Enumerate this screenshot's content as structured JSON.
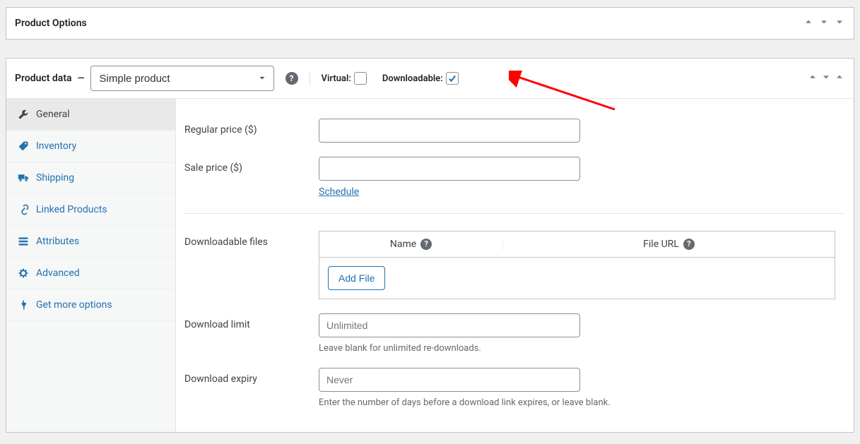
{
  "product_options": {
    "title": "Product Options"
  },
  "product_data": {
    "title": "Product data",
    "type_selected": "Simple product",
    "virtual": {
      "label": "Virtual:",
      "checked": false
    },
    "downloadable": {
      "label": "Downloadable:",
      "checked": true
    }
  },
  "tabs": {
    "general": "General",
    "inventory": "Inventory",
    "shipping": "Shipping",
    "linked": "Linked Products",
    "attributes": "Attributes",
    "advanced": "Advanced",
    "get_more": "Get more options"
  },
  "general": {
    "regular_price_label": "Regular price ($)",
    "sale_price_label": "Sale price ($)",
    "schedule_link": "Schedule",
    "downloadable_files_label": "Downloadable files",
    "col_name": "Name",
    "col_file_url": "File URL",
    "add_file_button": "Add File",
    "download_limit_label": "Download limit",
    "download_limit_placeholder": "Unlimited",
    "download_limit_help": "Leave blank for unlimited re-downloads.",
    "download_expiry_label": "Download expiry",
    "download_expiry_placeholder": "Never",
    "download_expiry_help": "Enter the number of days before a download link expires, or leave blank."
  }
}
